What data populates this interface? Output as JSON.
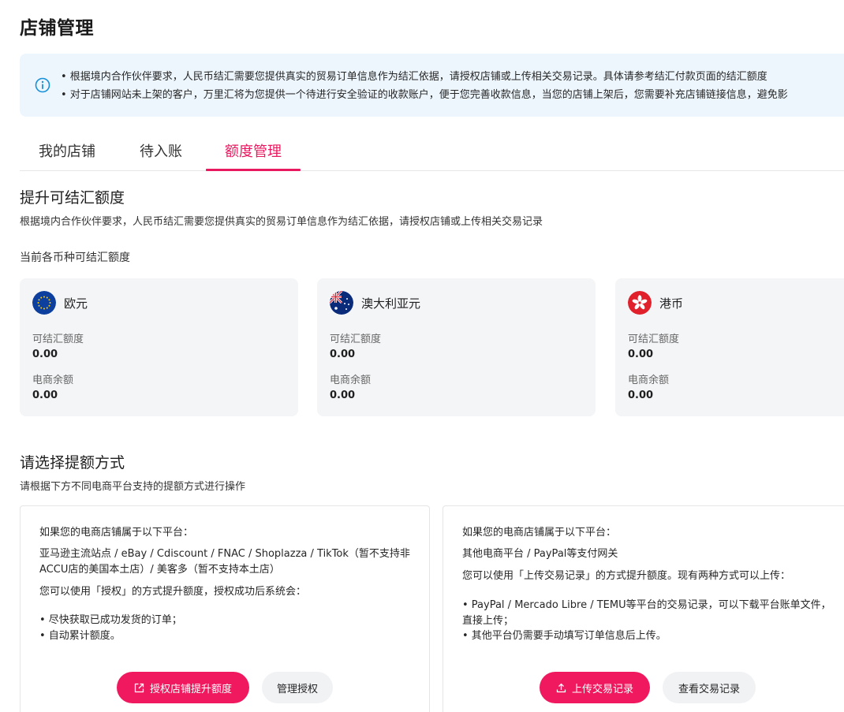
{
  "page": {
    "title": "店铺管理"
  },
  "notice": {
    "line1": "• 根据境内合作伙伴要求，人民币结汇需要您提供真实的贸易订单信息作为结汇依据，请授权店铺或上传相关交易记录。具体请参考结汇付款页面的结汇额度",
    "line2": "• 对于店铺网站未上架的客户，万里汇将为您提供一个待进行安全验证的收款账户，便于您完善收款信息，当您的店铺上架后，您需要补充店铺链接信息，避免影"
  },
  "tabs": [
    {
      "label": "我的店铺"
    },
    {
      "label": "待入账"
    },
    {
      "label": "额度管理",
      "active": true
    }
  ],
  "quota": {
    "title": "提升可结汇额度",
    "desc": "根据境内合作伙伴要求，人民币结汇需要您提供真实的贸易订单信息作为结汇依据，请授权店铺或上传相关交易记录",
    "subheading": "当前各币种可结汇额度",
    "currencies": [
      {
        "name": "欧元",
        "flag": "eu-flag-icon",
        "label1": "可结汇额度",
        "value1": "0.00",
        "label2": "电商余额",
        "value2": "0.00"
      },
      {
        "name": "澳大利亚元",
        "flag": "au-flag-icon",
        "label1": "可结汇额度",
        "value1": "0.00",
        "label2": "电商余额",
        "value2": "0.00"
      },
      {
        "name": "港币",
        "flag": "hk-flag-icon",
        "label1": "可结汇额度",
        "value1": "0.00",
        "label2": "电商余额",
        "value2": "0.00"
      }
    ]
  },
  "methods": {
    "title": "请选择提额方式",
    "desc": "请根据下方不同电商平台支持的提额方式进行操作",
    "left": {
      "intro": "如果您的电商店铺属于以下平台：",
      "platforms": "亚马逊主流站点 / eBay / Cdiscount / FNAC / Shoplazza / TikTok（暂不支持非ACCU店的美国本土店）/ 美客多（暂不支持本土店）",
      "how": "您可以使用「授权」的方式提升额度，授权成功后系统会：",
      "bullet1": "• 尽快获取已成功发货的订单；",
      "bullet2": "• 自动累计额度。",
      "primary_btn": "授权店铺提升额度",
      "primary_icon": "external-link-icon",
      "secondary_btn": "管理授权"
    },
    "right": {
      "intro": "如果您的电商店铺属于以下平台：",
      "platforms": "其他电商平台 / PayPal等支付网关",
      "how": "您可以使用「上传交易记录」的方式提升额度。现有两种方式可以上传：",
      "bullet1": "• PayPal / Mercado Libre / TEMU等平台的交易记录，可以下载平台账单文件，直接上传；",
      "bullet2": "• 其他平台仍需要手动填写订单信息后上传。",
      "primary_btn": "上传交易记录",
      "primary_icon": "upload-icon",
      "secondary_btn": "查看交易记录"
    }
  },
  "colors": {
    "accent": "#e8195f",
    "notice_bg": "#edf6fd",
    "info_icon": "#1890d8",
    "card_bg": "#f4f5f7"
  }
}
